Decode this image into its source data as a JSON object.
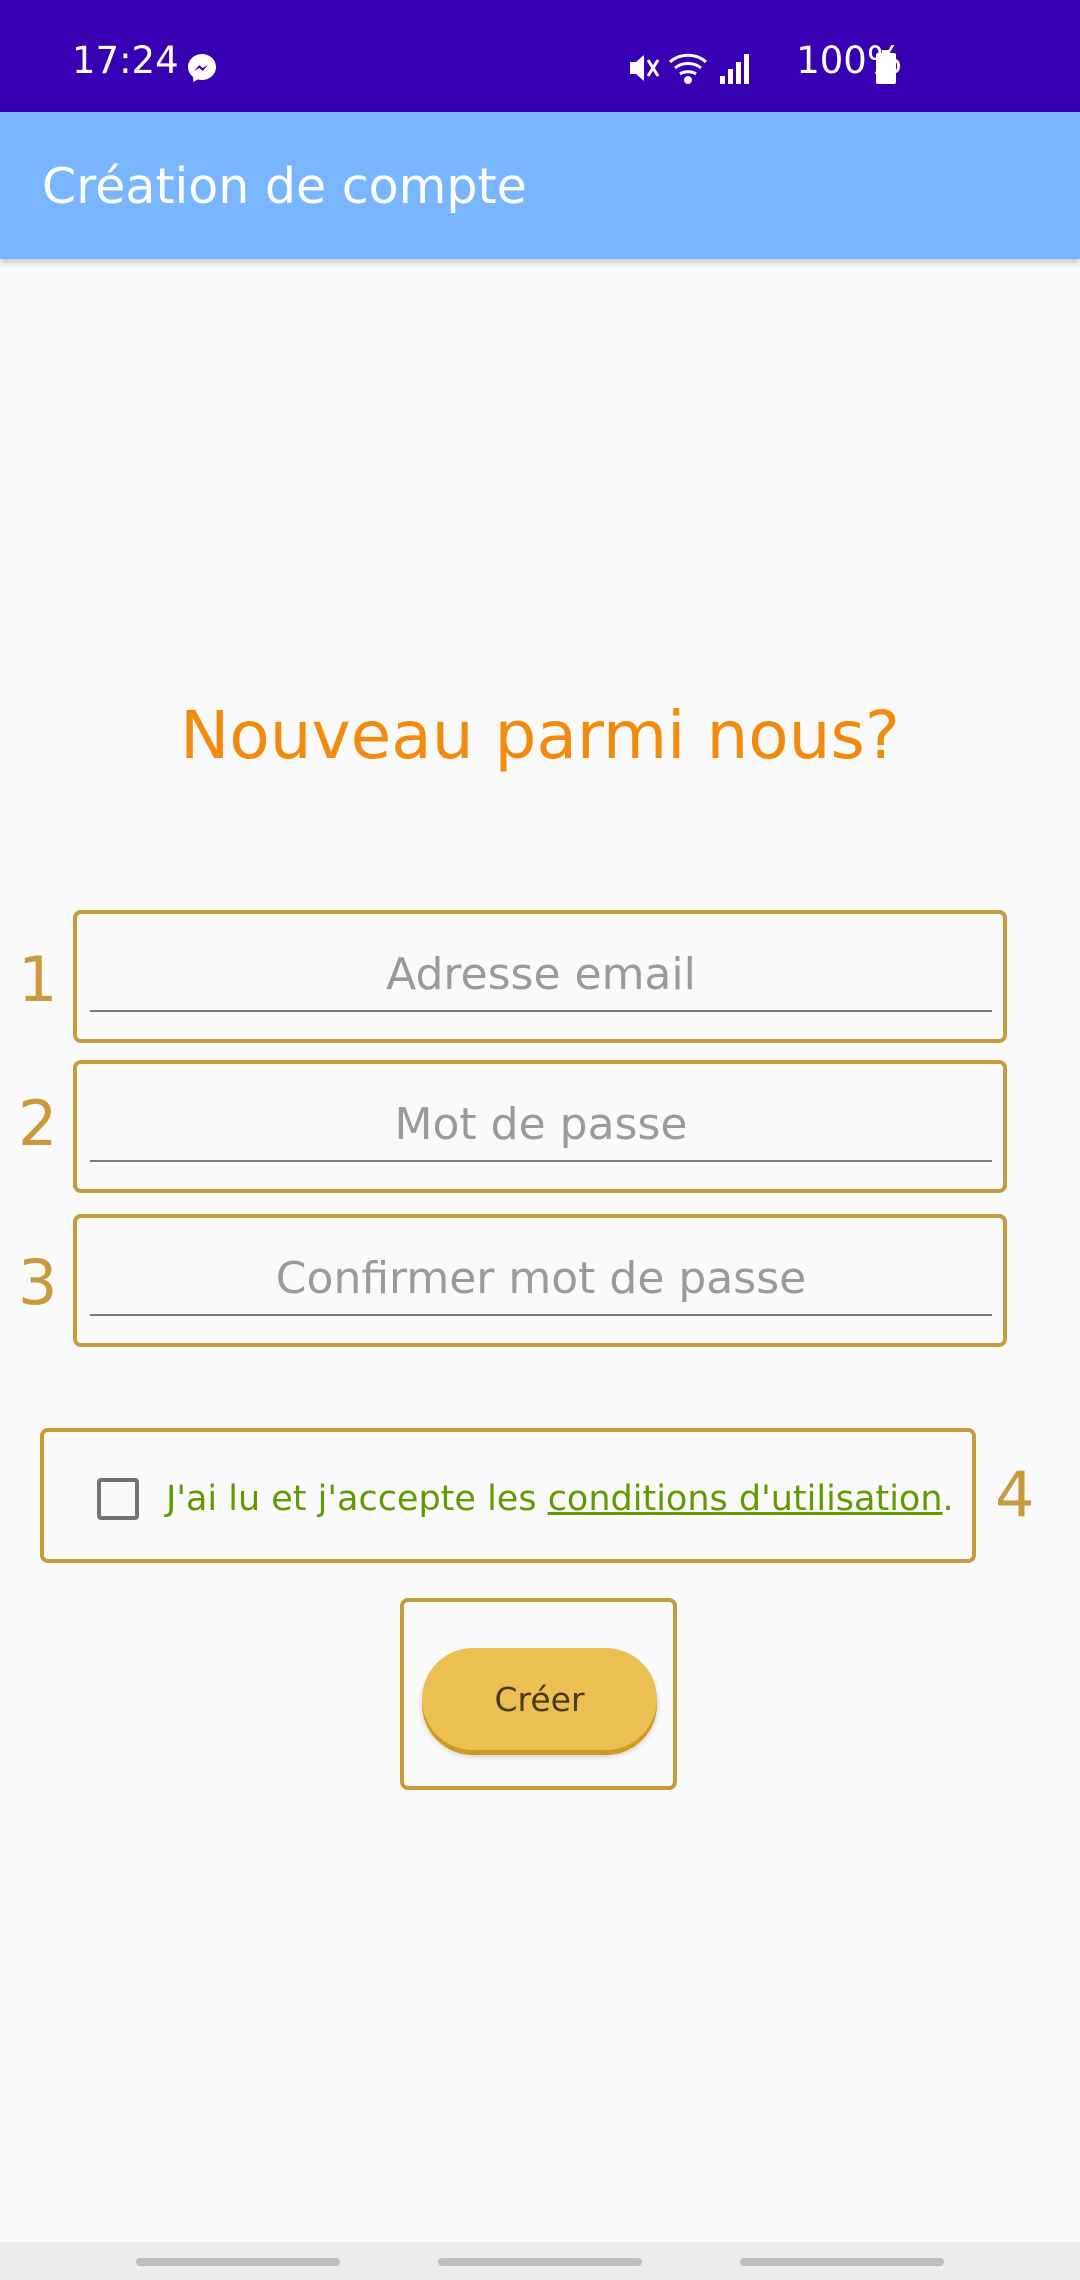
{
  "status_bar": {
    "time": "17:24",
    "battery": "100%",
    "bg_color": "#3700b3",
    "icons": [
      "messenger-icon",
      "mute-icon",
      "wifi-icon",
      "signal-icon",
      "battery-icon"
    ]
  },
  "app_bar": {
    "title": "Création de compte",
    "bg_color": "#79b6ff"
  },
  "form": {
    "heading": "Nouveau parmi nous?",
    "heading_color": "#f28a0e",
    "fields": [
      {
        "number": "1",
        "placeholder": "Adresse email",
        "value": ""
      },
      {
        "number": "2",
        "placeholder": "Mot de passe",
        "value": ""
      },
      {
        "number": "3",
        "placeholder": "Confirmer mot de passe",
        "value": ""
      }
    ],
    "terms": {
      "number": "4",
      "checked": false,
      "text_before": "J'ai lu et j'accepte les ",
      "link_text": "conditions d'utilisation",
      "text_after": "."
    },
    "submit_label": "Créer",
    "annotation_color": "#c99a3b",
    "button_color": "#ecbf52"
  }
}
